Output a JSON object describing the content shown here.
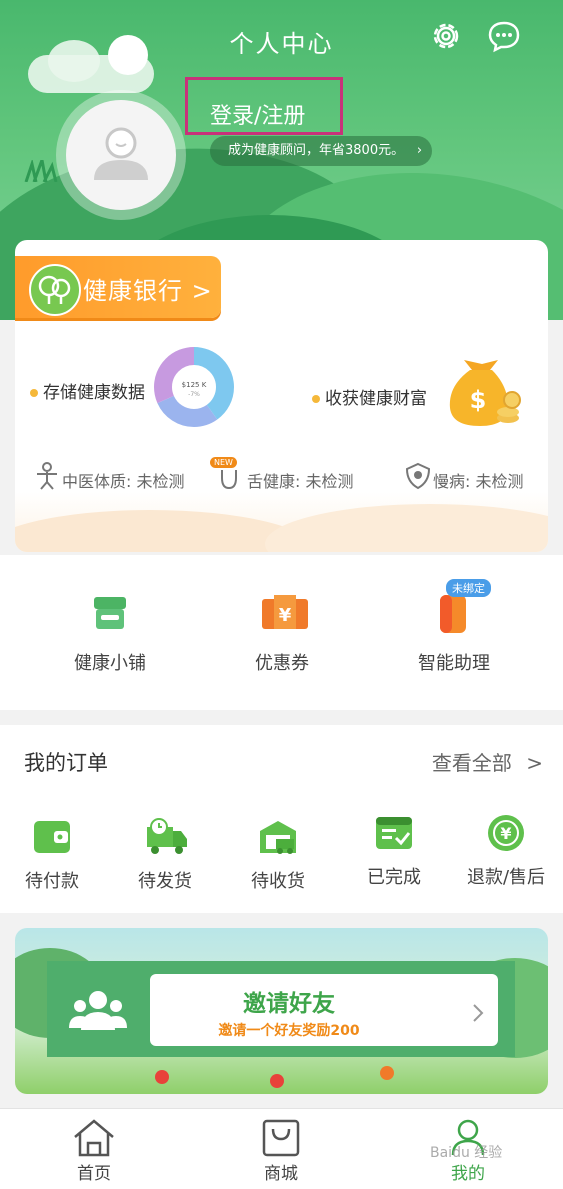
{
  "header": {
    "title": "个人中心",
    "login_label": "登录/注册",
    "consult_text": "成为健康顾问，年省3800元。",
    "consult_chevron": "›",
    "icons": [
      "gear-icon",
      "chat-bubble-icon"
    ]
  },
  "health_bank": {
    "tab_label": "健康银行 >",
    "store_data_label": "存储健康数据",
    "reap_wealth_label": "收获健康财富",
    "chart_main": "$125 K",
    "chart_sub": "-7%",
    "statuses": [
      {
        "label": "中医体质: 未检测",
        "icon": "body-figure-icon"
      },
      {
        "label": "舌健康: 未检测",
        "icon": "tongue-icon",
        "badge": "NEW"
      },
      {
        "label": "慢病: 未检测",
        "icon": "shield-heart-icon"
      }
    ]
  },
  "services": [
    {
      "label": "健康小铺",
      "icon": "shop-icon"
    },
    {
      "label": "优惠券",
      "icon": "coupon-icon"
    },
    {
      "label": "智能助理",
      "icon": "assistant-device-icon",
      "badge": "未绑定"
    }
  ],
  "orders": {
    "title": "我的订单",
    "view_all": "查看全部",
    "items": [
      {
        "label": "待付款",
        "icon": "wallet-icon"
      },
      {
        "label": "待发货",
        "icon": "truck-clock-icon"
      },
      {
        "label": "待收货",
        "icon": "warehouse-truck-icon"
      },
      {
        "label": "已完成",
        "icon": "checklist-icon"
      },
      {
        "label": "退款/售后",
        "icon": "yen-refund-icon"
      }
    ]
  },
  "invite": {
    "title": "邀请好友",
    "subtitle": "邀请一个好友奖励200",
    "icon": "people-group-icon"
  },
  "bottom_nav": [
    {
      "label": "首页",
      "icon": "home-icon"
    },
    {
      "label": "商城",
      "icon": "shopping-bag-icon"
    },
    {
      "label": "我的",
      "icon": "person-icon",
      "active": true
    }
  ],
  "watermark": "Baidu 经验",
  "colors": {
    "primary_green": "#3ea54a",
    "header_green": "#49b86d",
    "accent_orange": "#ff9b2b",
    "highlight_box": "#c8327a"
  }
}
